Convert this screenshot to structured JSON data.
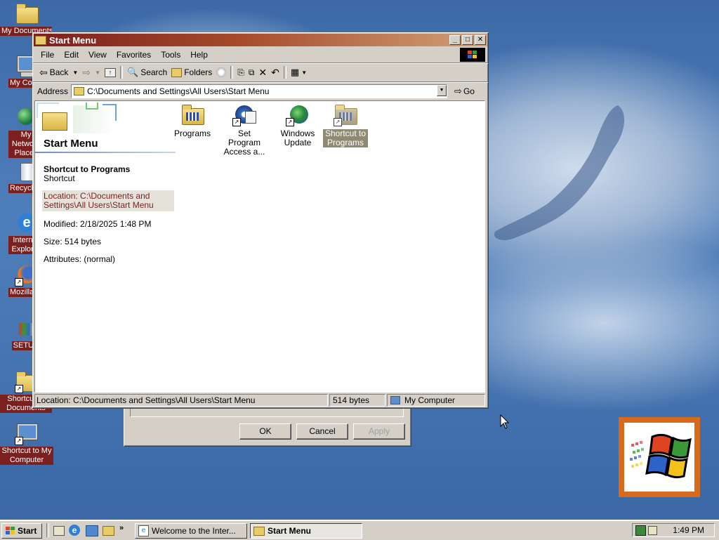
{
  "desktop": {
    "icons": [
      {
        "label": "My Documents"
      },
      {
        "label": "My Computer"
      },
      {
        "label": "My Network Places"
      },
      {
        "label": "Recycle Bin"
      },
      {
        "label": "Internet Explorer"
      },
      {
        "label": "Mozilla Firefox"
      },
      {
        "label": "SETUP"
      },
      {
        "label": "Shortcut to Documents"
      },
      {
        "label": "Shortcut to My Computer"
      }
    ]
  },
  "window": {
    "title": "Start Menu",
    "menu": [
      "File",
      "Edit",
      "View",
      "Favorites",
      "Tools",
      "Help"
    ],
    "toolbar": {
      "back": "Back",
      "search": "Search",
      "folders": "Folders"
    },
    "address": {
      "label": "Address",
      "value": "C:\\Documents and Settings\\All Users\\Start Menu",
      "go": "Go"
    },
    "left_panel": {
      "heading": "Start Menu",
      "item_name": "Shortcut to Programs",
      "item_type": "Shortcut",
      "location": "Location: C:\\Documents and Settings\\All Users\\Start Menu",
      "modified": "Modified: 2/18/2025 1:48 PM",
      "size": "Size: 514 bytes",
      "attributes": "Attributes: (normal)"
    },
    "files": [
      {
        "label": "Programs",
        "icon": "programs-folder-icon",
        "selected": false
      },
      {
        "label": "Set Program Access a...",
        "icon": "set-program-access-icon",
        "selected": false
      },
      {
        "label": "Windows Update",
        "icon": "windows-update-icon",
        "selected": false
      },
      {
        "label": "Shortcut to Programs",
        "icon": "shortcut-programs-icon",
        "selected": true
      }
    ],
    "status": {
      "location": "Location: C:\\Documents and Settings\\All Users\\Start Menu",
      "size": "514 bytes",
      "zone": "My Computer"
    }
  },
  "dialog_behind": {
    "ok": "OK",
    "cancel": "Cancel",
    "apply": "Apply"
  },
  "taskbar": {
    "start": "Start",
    "tasks": [
      {
        "label": "Welcome to the Inter...",
        "active": false
      },
      {
        "label": "Start Menu",
        "active": true
      }
    ],
    "clock": "1:49 PM"
  },
  "colors": {
    "titlebar": "#7b1f1f",
    "face": "#d4d0c8",
    "desktop": "#3d6aa7"
  }
}
